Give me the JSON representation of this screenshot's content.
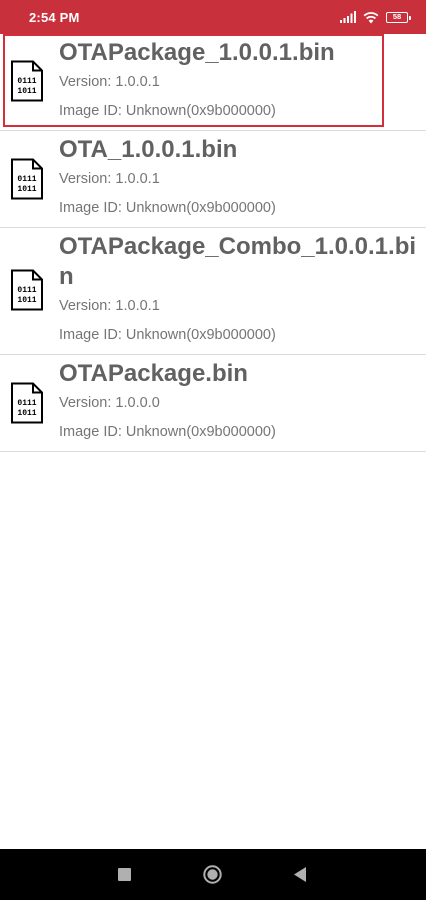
{
  "status_bar": {
    "time": "2:54 PM",
    "battery_level": "58",
    "icons": [
      "signal-icon",
      "wifi-icon",
      "battery-icon"
    ],
    "color": "#c8313c"
  },
  "files": [
    {
      "name": "OTAPackage_1.0.0.1.bin",
      "version": "Version: 1.0.0.1",
      "image_id": "Image ID: Unknown(0x9b000000)",
      "icon": "binary-file-icon",
      "selected": true
    },
    {
      "name": "OTA_1.0.0.1.bin",
      "version": "Version: 1.0.0.1",
      "image_id": "Image ID: Unknown(0x9b000000)",
      "icon": "binary-file-icon",
      "selected": false
    },
    {
      "name": "OTAPackage_Combo_1.0.0.1.bin",
      "version": "Version: 1.0.0.1",
      "image_id": "Image ID: Unknown(0x9b000000)",
      "icon": "binary-file-icon",
      "selected": false
    },
    {
      "name": "OTAPackage.bin",
      "version": "Version: 1.0.0.0",
      "image_id": "Image ID: Unknown(0x9b000000)",
      "icon": "binary-file-icon",
      "selected": false
    }
  ],
  "icon_text": {
    "line1": "0111",
    "line2": "1011"
  },
  "nav_bar": {
    "buttons": [
      "recents-button",
      "home-button",
      "back-button"
    ]
  },
  "colors": {
    "selection_border": "#d32f3a",
    "file_name": "#616161",
    "file_meta": "#757575"
  }
}
